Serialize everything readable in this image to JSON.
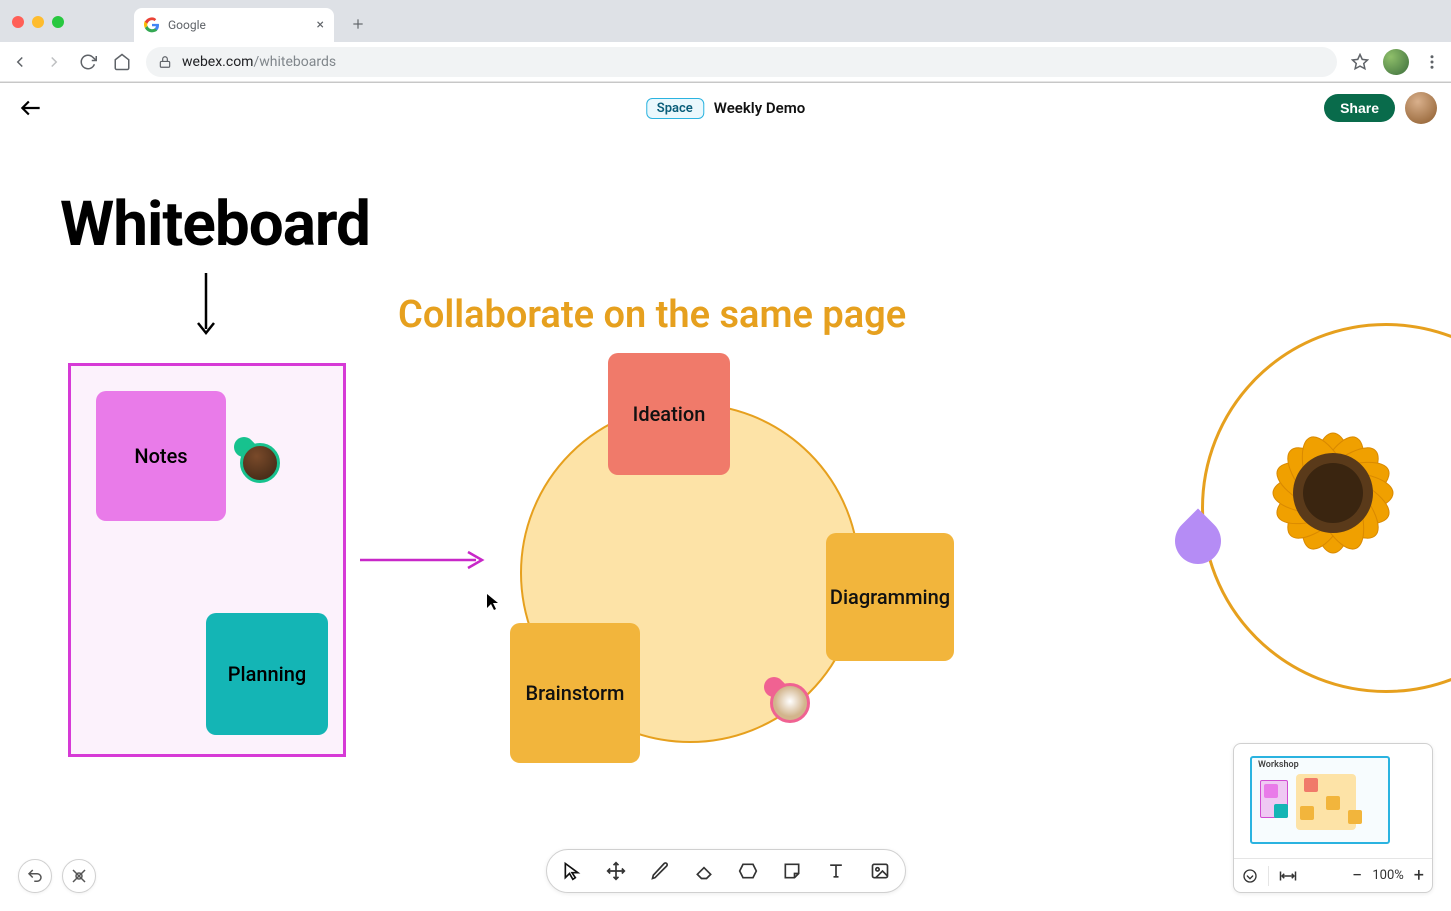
{
  "browser": {
    "tab_title": "Google",
    "url_host": "webex.com",
    "url_path": "/whiteboards"
  },
  "header": {
    "space_badge": "Space",
    "doc_title": "Weekly Demo",
    "share_label": "Share"
  },
  "canvas": {
    "title": "Whiteboard",
    "subtitle": "Collaborate on the same page",
    "stickies": {
      "notes": "Notes",
      "planning": "Planning",
      "ideation": "Ideation",
      "brainstorm": "Brainstorm",
      "diagramming": "Diagramming"
    }
  },
  "minimap": {
    "label": "Workshop",
    "zoom": "100%"
  }
}
